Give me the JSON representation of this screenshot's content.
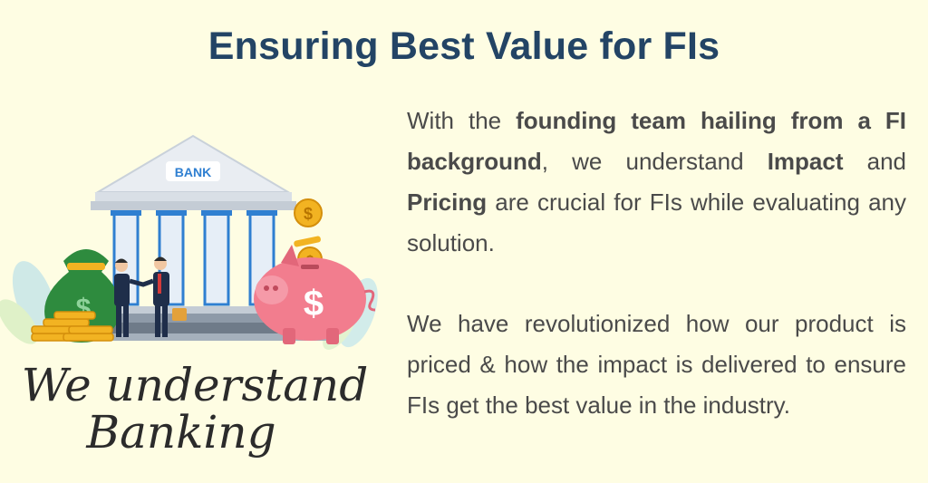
{
  "heading": "Ensuring Best Value for FIs",
  "illustration": {
    "bank_sign": "BANK",
    "caption_line1": "We understand",
    "caption_line2": "Banking",
    "currency_symbol": "$"
  },
  "paragraph1": {
    "p1": "With the ",
    "b1": "founding team hailing from a FI background",
    "p2": ", we understand ",
    "b2": "Impact",
    "p3": " and ",
    "b3": "Pricing",
    "p4": " are crucial for FIs while evaluating any solution."
  },
  "paragraph2": "We have revolutionized how our product is priced & how the impact is delivered to ensure FIs get the best value in the industry.",
  "colors": {
    "background": "#fefde3",
    "title": "#234465",
    "body_text": "#4a4a4a",
    "bank_blue": "#2f7fd1",
    "money_green": "#2e8b3e",
    "coin_gold": "#f2b322",
    "piggy_pink": "#f27d8e"
  }
}
